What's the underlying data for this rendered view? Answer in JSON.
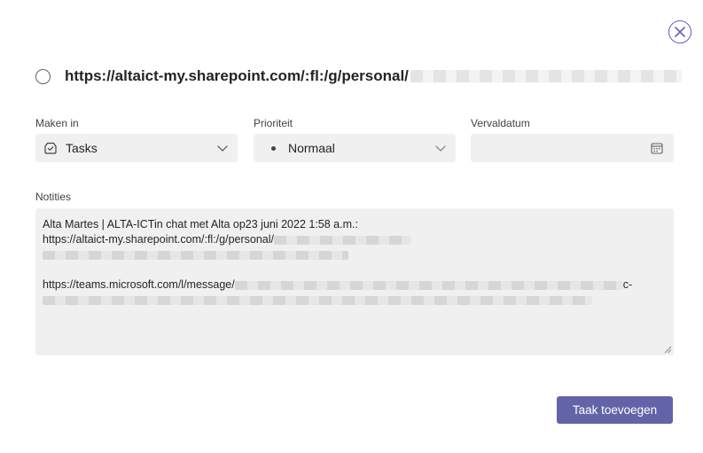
{
  "dialog": {
    "close_icon": "close-circle-icon",
    "title": "https://altaict-my.sharepoint.com/:fl:/g/personal/"
  },
  "fields": {
    "create_in": {
      "label": "Maken in",
      "value": "Tasks",
      "icon": "list-check-icon"
    },
    "priority": {
      "label": "Prioriteit",
      "value": "Normaal",
      "icon": "bullet-icon"
    },
    "due_date": {
      "label": "Vervaldatum",
      "value": "",
      "icon": "calendar-icon"
    }
  },
  "notes": {
    "label": "Notities",
    "line1": "Alta Martes | ALTA-ICTin chat met Alta op23 juni 2022 1:58 a.m.:",
    "line2": "https://altaict-my.sharepoint.com/:fl:/g/personal/",
    "line3": "https://teams.microsoft.com/l/message/",
    "line3_suffix": "c-"
  },
  "actions": {
    "submit_label": "Taak toevoegen"
  },
  "colors": {
    "accent": "#6264a7",
    "close": "#5b5fc7",
    "field_bg": "#f0f0f0"
  }
}
